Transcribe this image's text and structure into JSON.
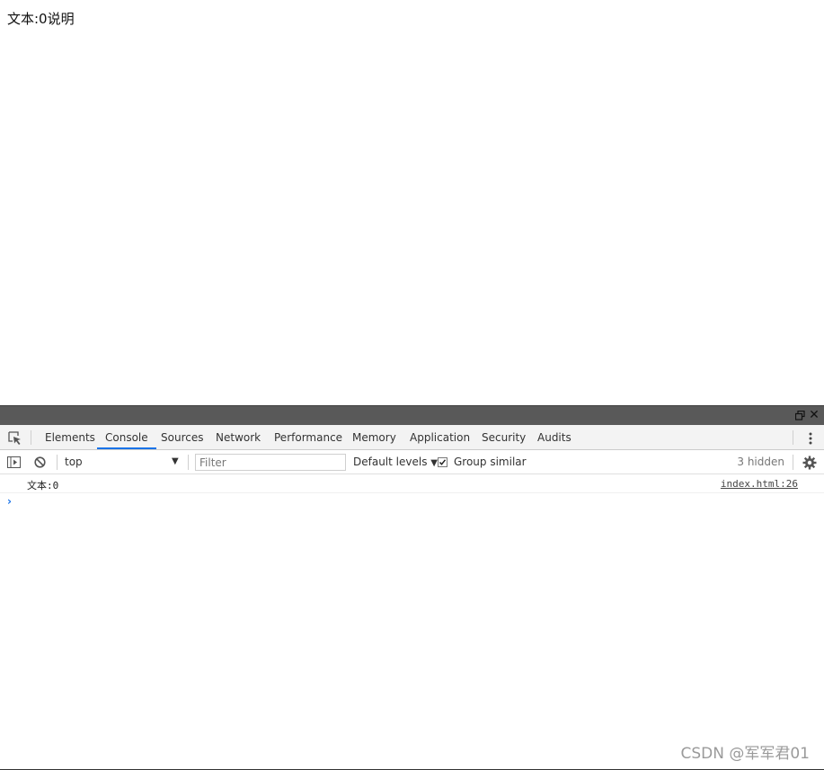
{
  "page": {
    "text": "文本:0说明"
  },
  "devtools": {
    "tabs": [
      "Elements",
      "Console",
      "Sources",
      "Network",
      "Performance",
      "Memory",
      "Application",
      "Security",
      "Audits"
    ],
    "active_tab": "Console",
    "toolbar": {
      "context": "top",
      "filter_placeholder": "Filter",
      "levels": "Default levels",
      "group_similar_label": "Group similar",
      "group_similar_checked": true,
      "hidden_count": "3 hidden"
    },
    "console": {
      "messages": [
        {
          "text": "文本:0",
          "source": "index.html:26"
        }
      ],
      "prompt": "›"
    },
    "icons": {
      "inspect": "inspect-element-icon",
      "restore": "restore-window-icon",
      "close": "close-icon",
      "more": "more-vertical-icon",
      "sidebar": "sidebar-toggle-icon",
      "clear": "clear-console-icon",
      "settings": "gear-icon"
    }
  },
  "watermark": "CSDN @军军君01",
  "colors": {
    "titlebar": "#595959",
    "active_tab_underline": "#1a73e8",
    "prompt": "#1a73e8"
  }
}
